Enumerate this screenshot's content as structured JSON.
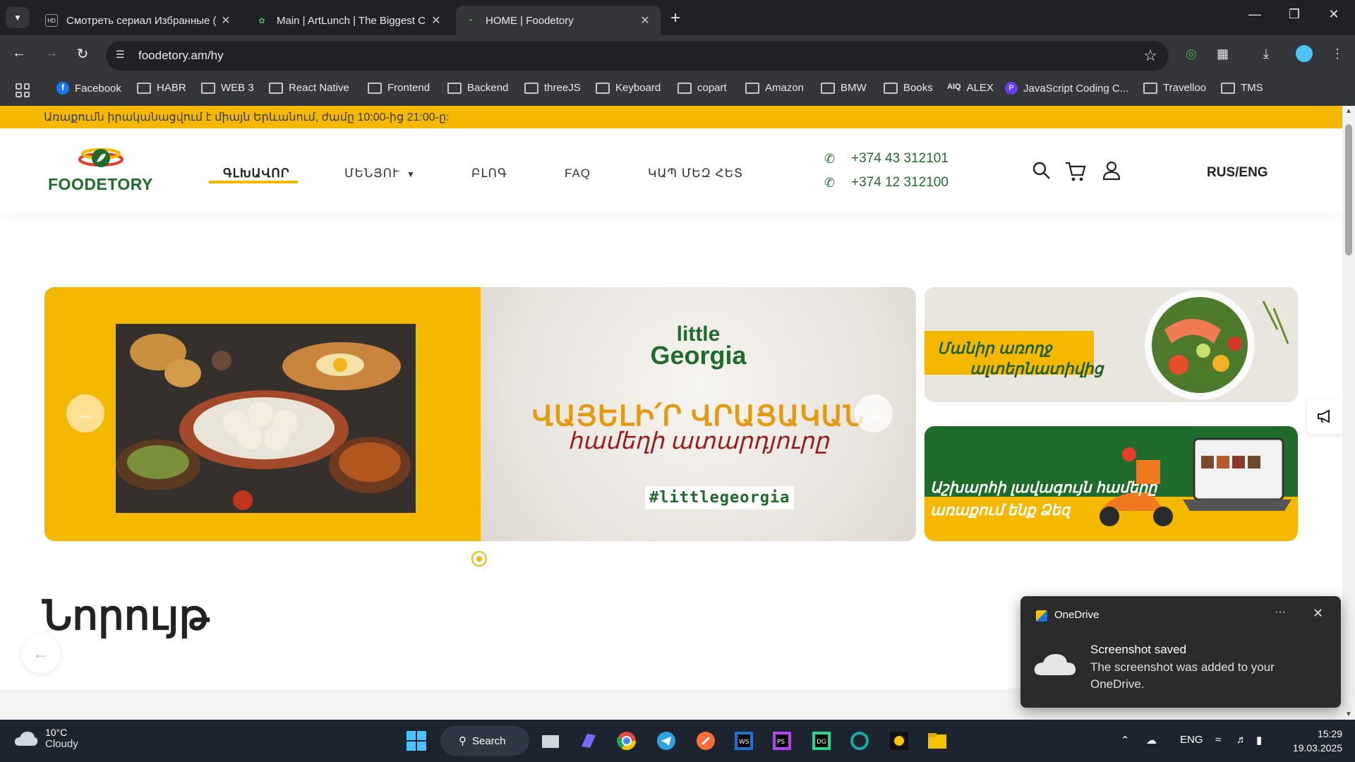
{
  "browser": {
    "tabs": [
      {
        "title": "Смотреть сериал Избранные (",
        "active": false
      },
      {
        "title": "Main | ArtLunch | The Biggest C",
        "active": false
      },
      {
        "title": "HOME | Foodetory",
        "active": true
      }
    ],
    "url": "foodetory.am/hy",
    "bookmarks": [
      "Facebook",
      "HABR",
      "WEB 3",
      "React Native",
      "Frontend",
      "Backend",
      "threeJS",
      "Keyboard",
      "copart",
      "Amazon",
      "BMW",
      "Books",
      "ALEX",
      "JavaScript Coding C...",
      "Travelloo",
      "TMS"
    ]
  },
  "site": {
    "announcement": "Առաքումն իրականացվում է միայն Երևանում, ժամը 10:00-ից 21:00-ը:",
    "logo_text": "FOODETORY",
    "nav": [
      "ԳԼԽԱՎՈՐ",
      "ՄԵՆՅՈՒ",
      "ԲԼՈԳ",
      "FAQ",
      "ԿԱՊ ՄԵԶ ՀԵՏ"
    ],
    "phones": [
      "+374 43 312101",
      "+374 12 312100"
    ],
    "lang_switch": "RUS/ENG",
    "hero": {
      "brand_line1": "little",
      "brand_line2": "Georgia",
      "headline": "ՎԱՅԵԼԻ՛Ր ՎՐԱՑԱԿԱՆ",
      "subline": "համեղի ատարդյուրը",
      "hashtag": "#littlegeorgia"
    },
    "promo1_text": [
      "Մանիր առողջ",
      "ալտերնատիվից"
    ],
    "promo2_text": [
      "Աշխարհի լավագույն համերը",
      "առաքում ենք Ձեզ"
    ],
    "section_title": "Նորույթ"
  },
  "toast": {
    "app": "OneDrive",
    "title": "Screenshot saved",
    "body": "The screenshot was added to your OneDrive.",
    "more": "···",
    "close": "✕"
  },
  "taskbar": {
    "temp": "10°C",
    "condition": "Cloudy",
    "search": "Search",
    "lang": "ENG",
    "time": "15:29",
    "date": "19.03.2025"
  },
  "colors": {
    "brand_yellow": "#f5b800",
    "brand_green": "#1f6b2b",
    "headline_orange": "#e59a0e",
    "subline_red": "#9b1b1b"
  }
}
